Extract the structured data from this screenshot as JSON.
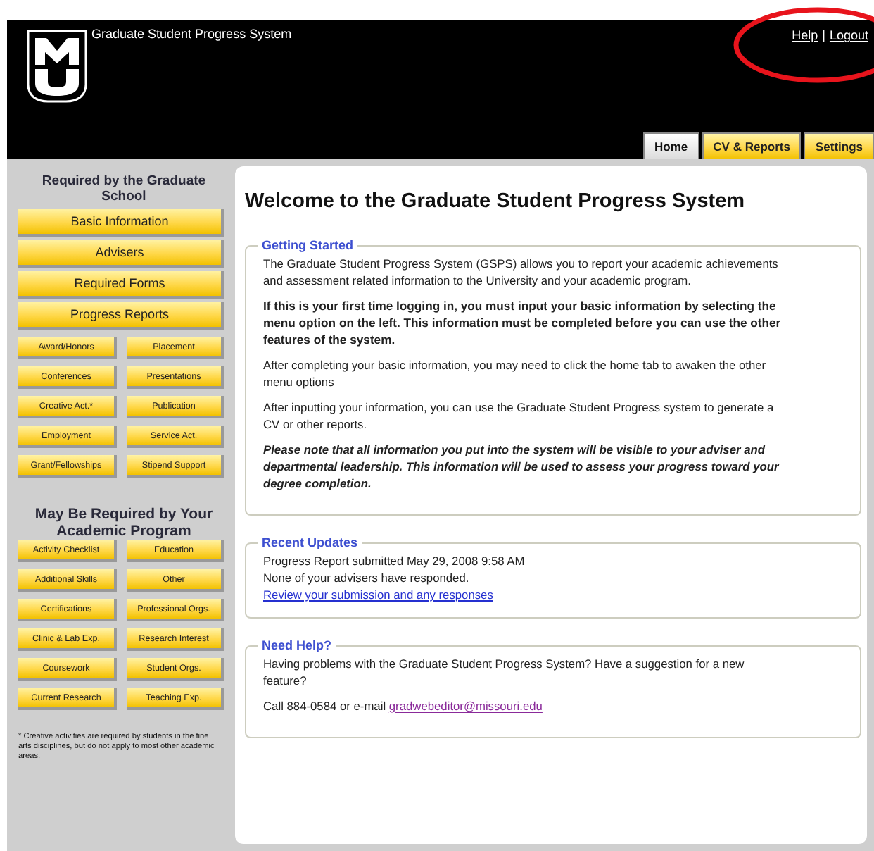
{
  "header": {
    "title": "Graduate Student Progress System",
    "links": [
      "Help",
      "Logout"
    ],
    "separator": "|"
  },
  "tabs": [
    {
      "label": "Home",
      "selected": true
    },
    {
      "label": "CV & Reports",
      "selected": false
    },
    {
      "label": "Settings",
      "selected": false
    }
  ],
  "highlight": {
    "kind": "ellipse",
    "color": "#e8141c"
  },
  "sidebar": {
    "sections": [
      {
        "heading": "Required by the Graduate School",
        "main_buttons": [
          "Basic Information",
          "Advisers",
          "Required Forms",
          "Progress Reports"
        ],
        "buttons": [
          "Award/Honors",
          "Placement",
          "Conferences",
          "Presentations",
          "Creative Act.*",
          "Publication",
          "Employment",
          "Service Act.",
          "Grant/Fellowships",
          "Stipend Support"
        ]
      },
      {
        "heading": "May Be Required by Your Academic Program",
        "buttons": [
          "Activity Checklist",
          "Education",
          "Additional Skills",
          "Other",
          "Certifications",
          "Professional Orgs.",
          "Clinic & Lab Exp.",
          "Research Interest",
          "Coursework",
          "Student Orgs.",
          "Current Research",
          "Teaching Exp."
        ]
      }
    ],
    "footnote": "* Creative activities are required by students in the fine arts disciplines, but do not apply to most other academic areas."
  },
  "main": {
    "title": "Welcome to the Graduate Student Progress System",
    "panels": [
      {
        "legend": "Getting Started",
        "items": [
          {
            "kind": "plain",
            "text": "The Graduate Student Progress System (GSPS) allows you to report your academic achievements and assessment related information to the University and your academic program."
          },
          {
            "kind": "bold",
            "text": "If this is your first time logging in, you must input your basic information by selecting the menu option on the left. This information must be completed before you can use the other features of the system."
          },
          {
            "kind": "plain",
            "text": "After completing your basic information, you may need to click the home tab to awaken the other menu options"
          },
          {
            "kind": "plain",
            "text": "After inputting your information, you can use the Graduate Student Progress system to generate a CV or other reports."
          },
          {
            "kind": "italic",
            "text": "Please note that all information you put into the system will be visible to your adviser and departmental leadership. This information will be used to assess your progress toward your degree completion."
          }
        ]
      },
      {
        "legend": "Recent Updates",
        "items": [
          {
            "kind": "line",
            "text": "Progress Report submitted May 29, 2008 9:58 AM"
          },
          {
            "kind": "line",
            "text": "None of your advisers have responded."
          },
          {
            "kind": "link",
            "text": "Review your submission and any responses"
          }
        ]
      },
      {
        "legend": "Need Help?",
        "items": [
          {
            "kind": "plain",
            "text": "Having problems with the Graduate Student Progress System? Have a suggestion for a new feature?"
          },
          {
            "kind": "contact",
            "text": "Call 884-0584 or e-mail",
            "link": "gradwebeditor@missouri.edu"
          }
        ]
      }
    ]
  }
}
